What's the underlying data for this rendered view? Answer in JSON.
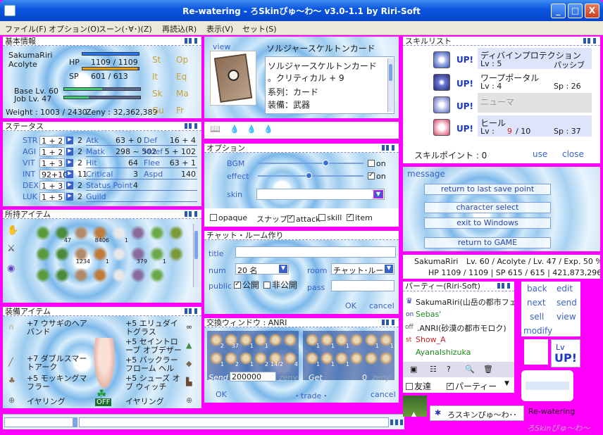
{
  "window": {
    "title": "Re-watering - ろSkinぴゅ～わ～ v3.0-1.1 by Riri-Soft",
    "btn_min": "_",
    "btn_max": "□",
    "btn_close": "X"
  },
  "menu": [
    "ファイル(F)",
    "オプション(O)",
    "スーン(･∀･)(Z)",
    "再読込(R)",
    "表示(V)",
    "セット(S)"
  ],
  "basic": {
    "title": "基本情報",
    "name": "SakumaRiri",
    "job": "Acolyte",
    "hp_label": "HP",
    "hp": "1109 / 1109",
    "sp_label": "SP",
    "sp": "601 / 613",
    "hp_ratio": 1.0,
    "sp_ratio": 0.98,
    "base_lv": "Base Lv. 60",
    "job_lv": "Job Lv. 47",
    "weight": "Weight : 1003 / 2430",
    "zeny": "Zeny : 32,362,389",
    "tabs": [
      "St",
      "Op",
      "It",
      "Eq",
      "Sk",
      "Ma",
      "Gu",
      "Fr"
    ]
  },
  "card": {
    "view": "view",
    "title": "ソルジャースケルトンカード",
    "name": "ソルジャースケルトンカード",
    "line1": "。クリティカル + 9",
    "line2": "系列：カード",
    "line3": "装備：武器"
  },
  "shortcut": {
    "title": ""
  },
  "status": {
    "title": "ステータス",
    "rows": [
      {
        "n": "STR",
        "v": "1 + 2",
        "p": "2",
        "k": "Atk",
        "kv": "63 + 0",
        "k2": "Def",
        "k2v": "16 + 4"
      },
      {
        "n": "AGI",
        "v": "1 + 2",
        "p": "2",
        "k": "Matk",
        "kv": "298 ~ 502",
        "k2": "Mdef",
        "k2v": "5 + 102"
      },
      {
        "n": "VIT",
        "v": "1 + 3",
        "p": "2",
        "k": "Hit",
        "kv": "64",
        "k2": "Flee",
        "k2v": "63 + 1"
      },
      {
        "n": "INT",
        "v": "92+10",
        "p": "11",
        "k": "Critical",
        "kv": "3",
        "k2": "Aspd",
        "k2v": "140"
      },
      {
        "n": "DEX",
        "v": "1 + 3",
        "p": "2",
        "k": "Status Point",
        "kv": "4",
        "k2": "",
        "k2v": ""
      },
      {
        "n": "LUK",
        "v": "1 + 5",
        "p": "2",
        "k": "Guild",
        "kv": "",
        "k2": "",
        "k2v": ""
      }
    ]
  },
  "options": {
    "title": "オプション",
    "bgm": "BGM",
    "effect": "effect",
    "skin": "skin",
    "on1": "on",
    "on2": "on",
    "opaque": "opaque",
    "snap": "スナップ",
    "attack": "attack",
    "skill": "skill",
    "item": "item"
  },
  "skills": {
    "title": "スキルリスト",
    "list": [
      {
        "up": "UP!",
        "name": "ディバインプロテクション",
        "lv": "Lv : 5",
        "extra": "パッシブ"
      },
      {
        "up": "UP!",
        "name": "ワープポータル",
        "lv": "Lv : 4",
        "extra": "Sp : 26"
      },
      {
        "up": "UP!",
        "name": "ニューマ",
        "lv": "",
        "extra": ""
      },
      {
        "up": "UP!",
        "name": "ヒール",
        "lv": "Lv :",
        "lvcur": "9",
        "lvmax": "/ 10",
        "extra": "Sp : 37"
      }
    ],
    "points": "スキルポイント : 0",
    "use": "use",
    "close": "close"
  },
  "inventory": {
    "title": "所持アイテム",
    "counts": [
      "",
      "47",
      "",
      "8406",
      "1",
      "",
      "",
      "",
      "",
      "",
      "1234",
      "1",
      "",
      "379",
      "1",
      "",
      "",
      "",
      "",
      "",
      "",
      "",
      ""
    ]
  },
  "chat": {
    "title": "チャット・ルーム作り",
    "label_title": "title",
    "label_num": "num",
    "num_val": "20 名",
    "label_room": "room",
    "room_val": "チャット･ルー",
    "label_public": "public",
    "public": "公開",
    "private": "非公開",
    "label_pass": "pass",
    "ok": "OK",
    "cancel": "cancel"
  },
  "message": {
    "title": "message",
    "b1": "return to last save point",
    "b2": "character select",
    "b3": "exit to Windows",
    "b4": "return to GAME"
  },
  "charinfo": {
    "name": "SakumaRiri",
    "detail": "Lv. 60 / Acolyte / Lv. 47 / Exp. 50 %",
    "line2": "HP 1109 / 1109  |  SP 615 / 615  |  421,873,296 Z"
  },
  "equip": {
    "title": "装備アイテム",
    "left": [
      "+7 ウサギのヘアバンド",
      "+7 ダブルスマートアーク",
      "+5 モッキングマフラー",
      "イヤリング"
    ],
    "right": [
      "+5 エリュダイトグラス",
      "+5 セイントローブ オブデザー",
      "+5 バックラーフローム ヘル",
      "+5 シューズ オブ ウィッチ",
      "イヤリング"
    ],
    "off": "OFF"
  },
  "trade": {
    "title": "交換ウィンドウ : ANRI",
    "send": "Send",
    "send_val": "200000",
    "zeny": "zeny",
    "get": "Get",
    "get_val": "0",
    "zeny2": "zeny",
    "ok": "OK",
    "trade": "・trade・",
    "cancel": "cancel",
    "left_counts": [
      "2",
      "37",
      "1",
      "1",
      "",
      "",
      "1",
      "2",
      "1",
      "2",
      "14/2",
      "4"
    ],
    "right_counts": [
      "1",
      "1",
      "1",
      "",
      "1",
      "1",
      "1",
      "1",
      "1",
      "",
      "",
      ""
    ]
  },
  "party": {
    "title": "パーティー(Riri-Soft)",
    "members": [
      {
        "tag": "",
        "name": "SakumaRiri(山岳の都市フェ"
      },
      {
        "tag": "on",
        "name": "Sebas'"
      },
      {
        "tag": "off",
        "name": ".ANRI(砂漠の都市モロク)"
      },
      {
        "tag": "st",
        "name": "Show_A"
      },
      {
        "tag": "",
        "name": "AyanaIshizuka"
      }
    ],
    "friend": "友達",
    "partychk": "パーティー"
  },
  "sidebtns": {
    "back": "back",
    "edit": "edit",
    "next": "next",
    "send": "send",
    "sell": "sell",
    "view": "view",
    "modify": "modify",
    "lvup_lv": "Lv",
    "lvup_up": "UP!"
  },
  "taskbar": {
    "item": "ろスキンぴゅ～わ･･",
    "app": "Re-watering",
    "logo": "ろSkinぴゅ～わ～"
  },
  "colors": {
    "accent": "#ff00ff",
    "hp": "#1f78ff",
    "sp": "#8fb8ff",
    "link": "#3a63c8"
  }
}
